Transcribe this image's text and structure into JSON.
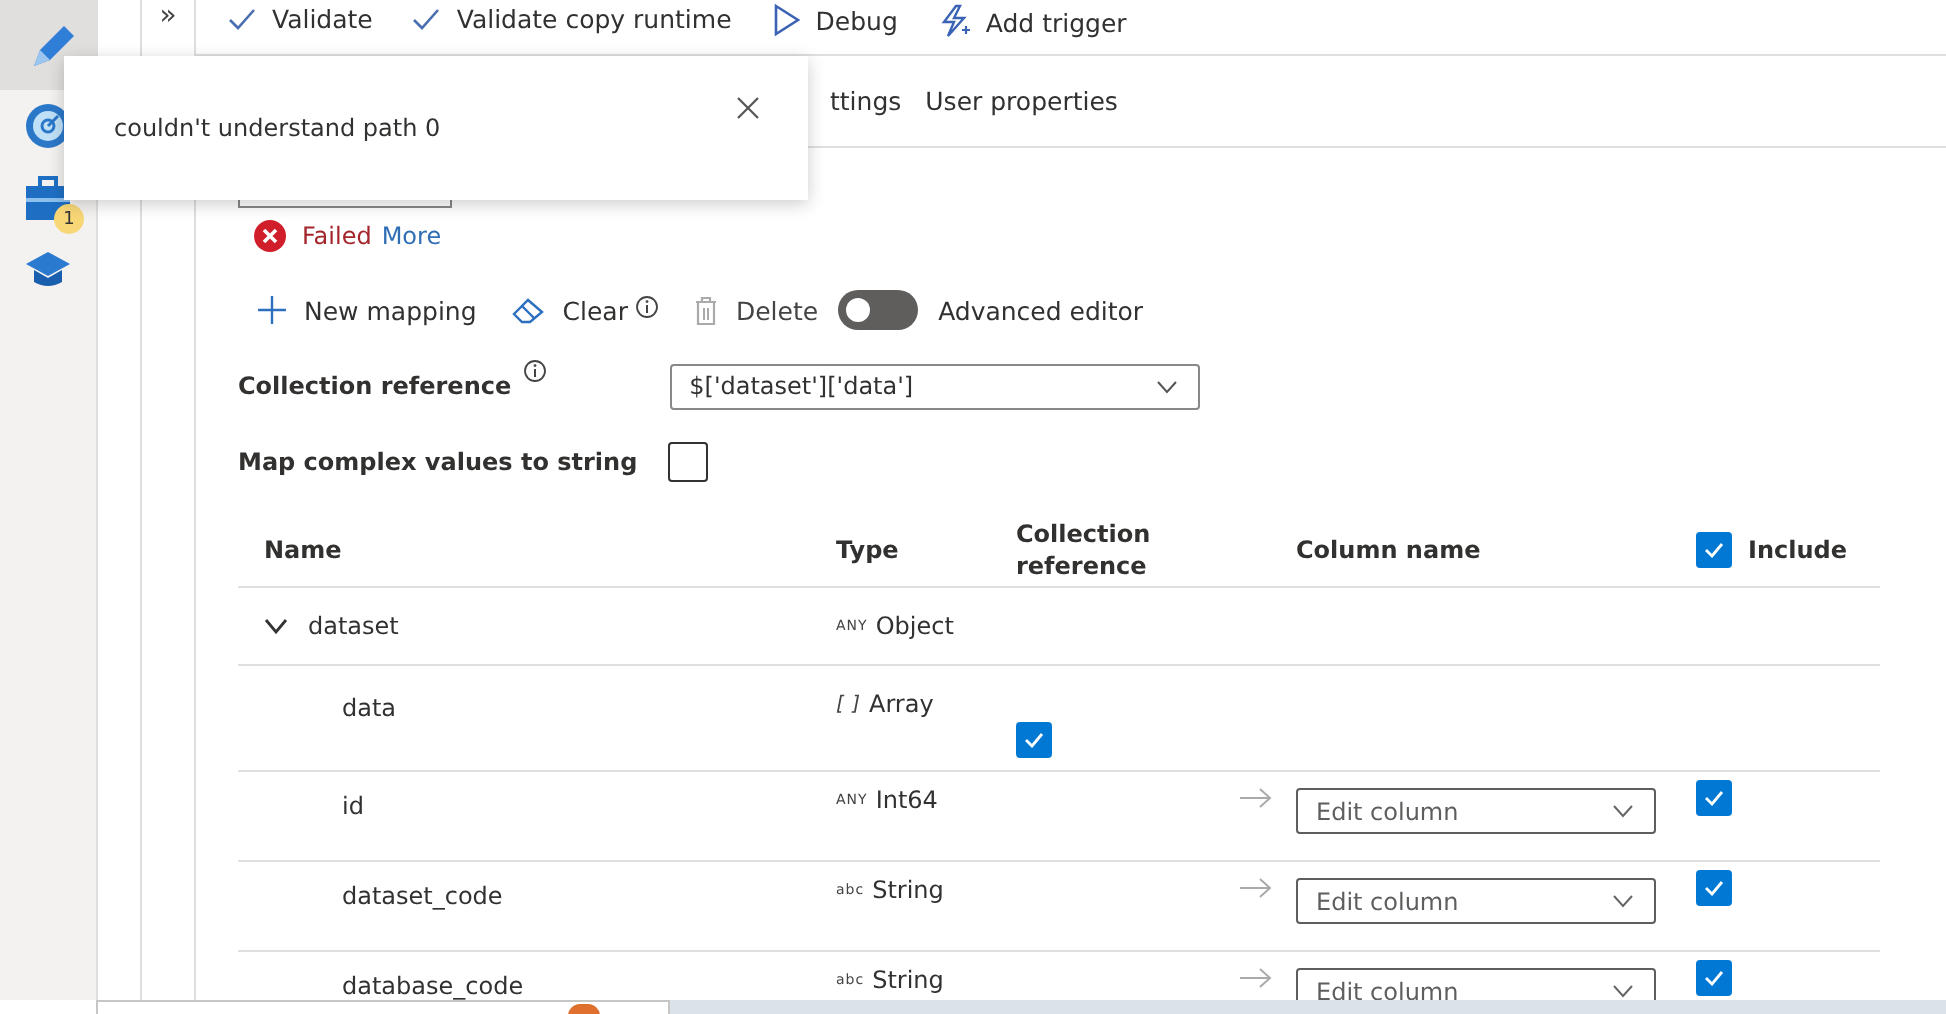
{
  "sidebar": {
    "items": [
      {
        "kind": "pencil",
        "selected": true
      },
      {
        "kind": "monitor",
        "selected": false
      },
      {
        "kind": "toolbox",
        "selected": false,
        "badge": "1"
      },
      {
        "kind": "learn",
        "selected": false
      }
    ]
  },
  "collapse_toggle": "»",
  "toolbar": [
    {
      "kind": "check",
      "label": "Validate"
    },
    {
      "kind": "check",
      "label": "Validate copy runtime"
    },
    {
      "kind": "play",
      "label": "Debug"
    },
    {
      "kind": "bolt",
      "label": "Add trigger"
    }
  ],
  "tabs": [
    {
      "label": "ttings",
      "selected": false
    },
    {
      "label": "User properties",
      "selected": false
    }
  ],
  "toast": {
    "message": "couldn't understand path 0"
  },
  "import_status": {
    "status": "Failed",
    "link": "More"
  },
  "actions": [
    {
      "kind": "plus",
      "label": "New mapping",
      "disabled": false,
      "info": false
    },
    {
      "kind": "eraser",
      "label": "Clear",
      "disabled": false,
      "info": true
    },
    {
      "kind": "trash",
      "label": "Delete",
      "disabled": true,
      "info": false
    }
  ],
  "advanced_editor": {
    "label": "Advanced editor",
    "on": false
  },
  "collection_reference": {
    "label": "Collection reference",
    "value": "$['dataset']['data']"
  },
  "map_complex": {
    "label": "Map complex values to string",
    "checked": false
  },
  "table": {
    "columns": [
      "Name",
      "Type",
      "Collection reference",
      "Column name",
      "Include"
    ],
    "include_all": true,
    "rows": [
      {
        "name": "dataset",
        "type_tag": "ANY",
        "type": "Object",
        "kind": "object",
        "expanded": true,
        "children": [
          {
            "name": "data",
            "type_tag": "[ ]",
            "type": "Array",
            "kind": "array",
            "collection_reference": true
          },
          {
            "name": "id",
            "type_tag": "ANY",
            "type": "Int64",
            "kind": "field",
            "column_placeholder": "Edit column",
            "include": true
          },
          {
            "name": "dataset_code",
            "type_tag": "abc",
            "type": "String",
            "kind": "field",
            "column_placeholder": "Edit column",
            "include": true
          },
          {
            "name": "database_code",
            "type_tag": "abc",
            "type": "String",
            "kind": "field",
            "column_placeholder": "Edit column",
            "include": true
          }
        ]
      }
    ]
  }
}
